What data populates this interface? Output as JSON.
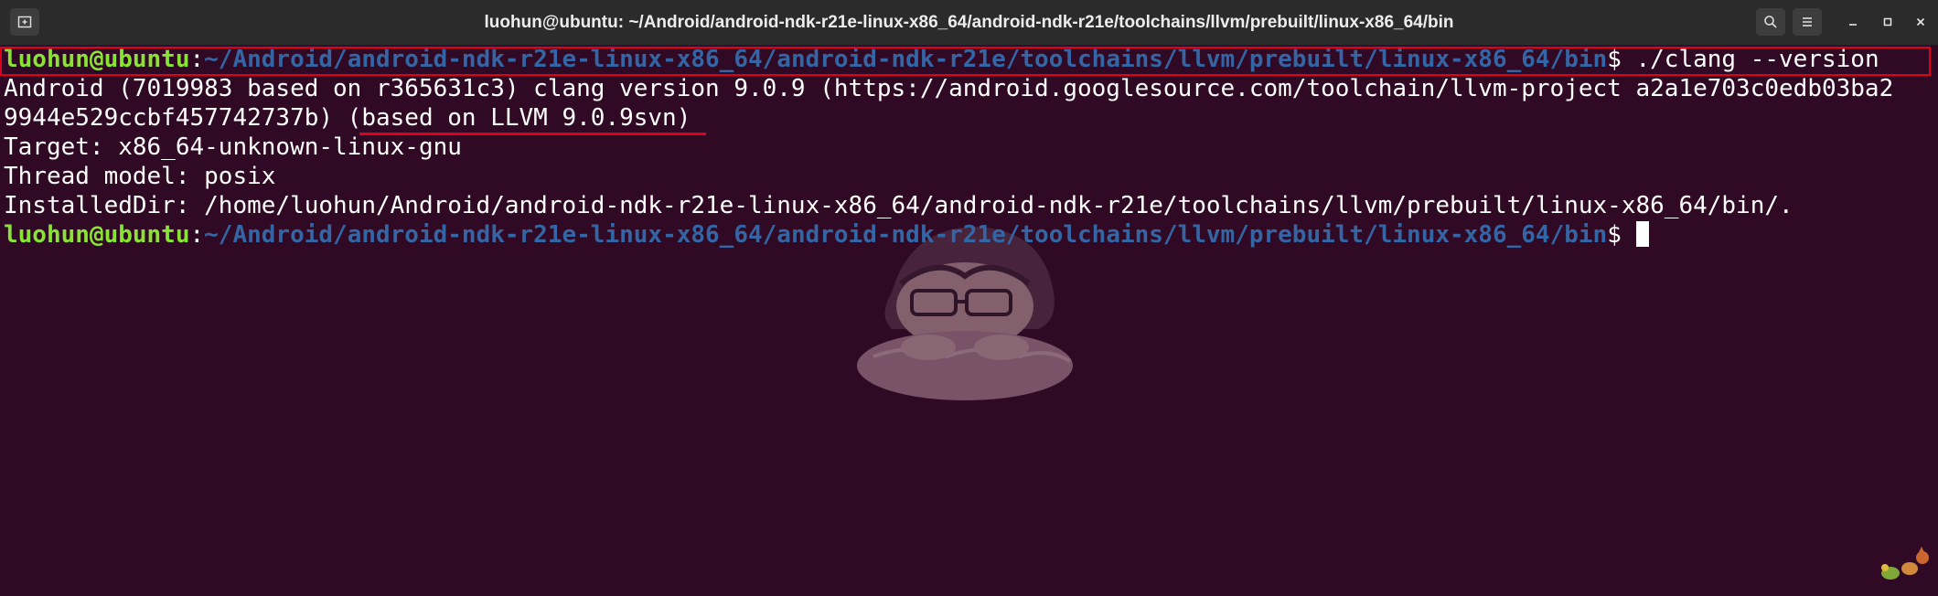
{
  "window": {
    "title": "luohun@ubuntu: ~/Android/android-ndk-r21e-linux-x86_64/android-ndk-r21e/toolchains/llvm/prebuilt/linux-x86_64/bin"
  },
  "titlebar": {
    "new_tab_icon": "new-tab-icon",
    "search_icon": "search-icon",
    "menu_icon": "hamburger-menu-icon",
    "minimize_icon": "minimize-icon",
    "maximize_icon": "maximize-icon",
    "close_icon": "close-icon"
  },
  "terminal": {
    "prompt1": {
      "user": "luohun@ubuntu",
      "colon": ":",
      "path": "~/Android/android-ndk-r21e-linux-x86_64/android-ndk-r21e/toolchains/llvm/prebuilt/linux-x86_64/bin",
      "dollar": "$ ",
      "command": "./clang --version"
    },
    "output": [
      "Android (7019983 based on r365631c3) clang version 9.0.9 (https://android.googlesource.com/toolchain/llvm-project a2a1e703c0edb03ba2",
      "9944e529ccbf457742737b) (based on LLVM 9.0.9svn)",
      "Target: x86_64-unknown-linux-gnu",
      "Thread model: posix",
      "InstalledDir: /home/luohun/Android/android-ndk-r21e-linux-x86_64/android-ndk-r21e/toolchains/llvm/prebuilt/linux-x86_64/bin/."
    ],
    "prompt2": {
      "user": "luohun@ubuntu",
      "colon": ":",
      "path": "~/Android/android-ndk-r21e-linux-x86_64/android-ndk-r21e/toolchains/llvm/prebuilt/linux-x86_64/bin",
      "dollar": "$ "
    }
  },
  "colors": {
    "background": "#300a24",
    "prompt_user": "#8ae234",
    "prompt_path": "#3465a4",
    "annotation": "#e0001b"
  }
}
